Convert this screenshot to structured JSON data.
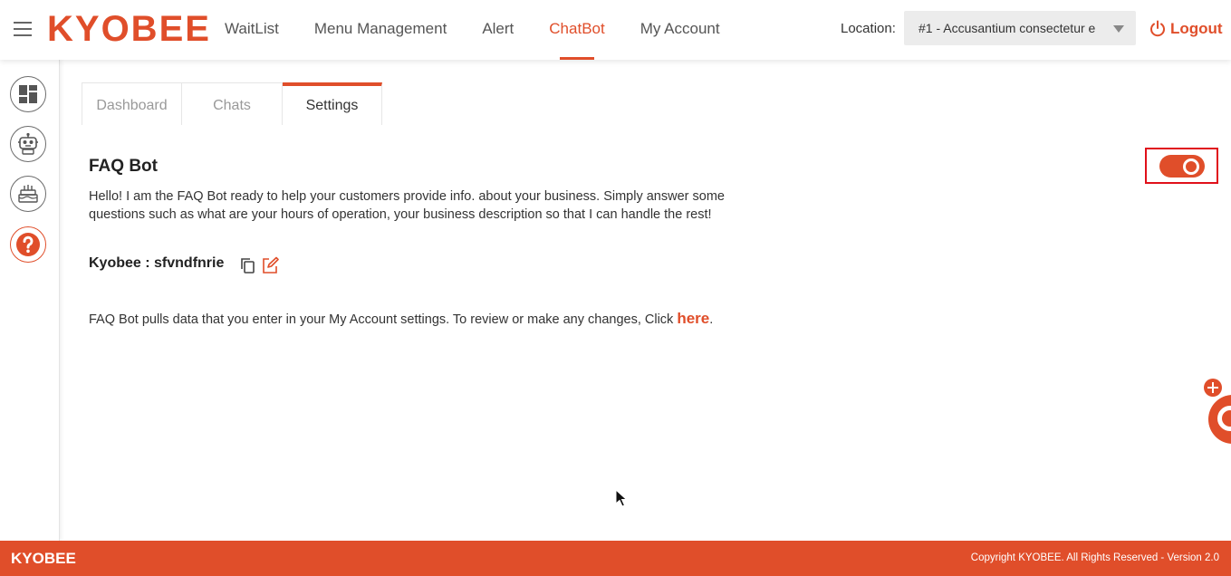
{
  "header": {
    "brand": "KYOBEE",
    "nav": [
      {
        "label": "WaitList"
      },
      {
        "label": "Menu Management"
      },
      {
        "label": "Alert"
      },
      {
        "label": "ChatBot",
        "active": true
      },
      {
        "label": "My Account"
      }
    ],
    "location_label": "Location:",
    "location_value": "#1 - Accusantium consectetur e",
    "logout_label": "Logout"
  },
  "rail": [
    {
      "icon": "dashboard-icon"
    },
    {
      "icon": "robot-icon"
    },
    {
      "icon": "cake-icon"
    },
    {
      "icon": "help-icon"
    }
  ],
  "tabs": [
    {
      "label": "Dashboard"
    },
    {
      "label": "Chats"
    },
    {
      "label": "Settings",
      "active": true
    }
  ],
  "faq": {
    "title": "FAQ Bot",
    "description": "Hello! I am the FAQ Bot ready to help your customers provide info. about your business. Simply answer some questions such as what are your hours of operation, your business description so that I can handle the rest!",
    "enabled": true,
    "bot_name": "Kyobee : sfvndfnrie",
    "note_prefix": "FAQ Bot pulls data that you enter in your My Account settings. To review or make any changes, Click ",
    "note_link": "here",
    "note_suffix": "."
  },
  "footer": {
    "brand": "KYOBEE",
    "copyright": "Copyright KYOBEE. All Rights Reserved - Version 2.0"
  },
  "colors": {
    "accent": "#e04e2a",
    "highlight_border": "#e0101a"
  }
}
